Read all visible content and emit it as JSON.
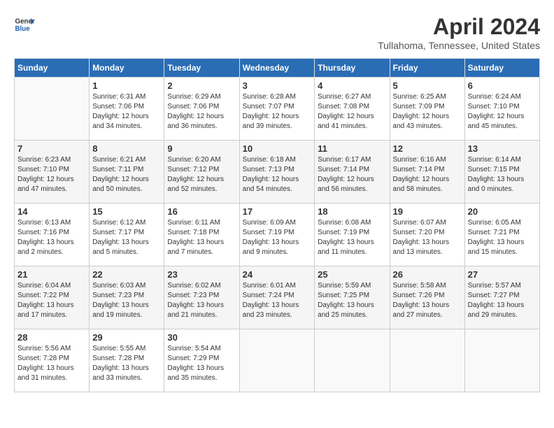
{
  "logo": {
    "general": "General",
    "blue": "Blue"
  },
  "title": {
    "month": "April 2024",
    "location": "Tullahoma, Tennessee, United States"
  },
  "headers": [
    "Sunday",
    "Monday",
    "Tuesday",
    "Wednesday",
    "Thursday",
    "Friday",
    "Saturday"
  ],
  "weeks": [
    [
      {
        "day": "",
        "sunrise": "",
        "sunset": "",
        "daylight": ""
      },
      {
        "day": "1",
        "sunrise": "Sunrise: 6:31 AM",
        "sunset": "Sunset: 7:06 PM",
        "daylight": "Daylight: 12 hours and 34 minutes."
      },
      {
        "day": "2",
        "sunrise": "Sunrise: 6:29 AM",
        "sunset": "Sunset: 7:06 PM",
        "daylight": "Daylight: 12 hours and 36 minutes."
      },
      {
        "day": "3",
        "sunrise": "Sunrise: 6:28 AM",
        "sunset": "Sunset: 7:07 PM",
        "daylight": "Daylight: 12 hours and 39 minutes."
      },
      {
        "day": "4",
        "sunrise": "Sunrise: 6:27 AM",
        "sunset": "Sunset: 7:08 PM",
        "daylight": "Daylight: 12 hours and 41 minutes."
      },
      {
        "day": "5",
        "sunrise": "Sunrise: 6:25 AM",
        "sunset": "Sunset: 7:09 PM",
        "daylight": "Daylight: 12 hours and 43 minutes."
      },
      {
        "day": "6",
        "sunrise": "Sunrise: 6:24 AM",
        "sunset": "Sunset: 7:10 PM",
        "daylight": "Daylight: 12 hours and 45 minutes."
      }
    ],
    [
      {
        "day": "7",
        "sunrise": "Sunrise: 6:23 AM",
        "sunset": "Sunset: 7:10 PM",
        "daylight": "Daylight: 12 hours and 47 minutes."
      },
      {
        "day": "8",
        "sunrise": "Sunrise: 6:21 AM",
        "sunset": "Sunset: 7:11 PM",
        "daylight": "Daylight: 12 hours and 50 minutes."
      },
      {
        "day": "9",
        "sunrise": "Sunrise: 6:20 AM",
        "sunset": "Sunset: 7:12 PM",
        "daylight": "Daylight: 12 hours and 52 minutes."
      },
      {
        "day": "10",
        "sunrise": "Sunrise: 6:18 AM",
        "sunset": "Sunset: 7:13 PM",
        "daylight": "Daylight: 12 hours and 54 minutes."
      },
      {
        "day": "11",
        "sunrise": "Sunrise: 6:17 AM",
        "sunset": "Sunset: 7:14 PM",
        "daylight": "Daylight: 12 hours and 56 minutes."
      },
      {
        "day": "12",
        "sunrise": "Sunrise: 6:16 AM",
        "sunset": "Sunset: 7:14 PM",
        "daylight": "Daylight: 12 hours and 58 minutes."
      },
      {
        "day": "13",
        "sunrise": "Sunrise: 6:14 AM",
        "sunset": "Sunset: 7:15 PM",
        "daylight": "Daylight: 13 hours and 0 minutes."
      }
    ],
    [
      {
        "day": "14",
        "sunrise": "Sunrise: 6:13 AM",
        "sunset": "Sunset: 7:16 PM",
        "daylight": "Daylight: 13 hours and 2 minutes."
      },
      {
        "day": "15",
        "sunrise": "Sunrise: 6:12 AM",
        "sunset": "Sunset: 7:17 PM",
        "daylight": "Daylight: 13 hours and 5 minutes."
      },
      {
        "day": "16",
        "sunrise": "Sunrise: 6:11 AM",
        "sunset": "Sunset: 7:18 PM",
        "daylight": "Daylight: 13 hours and 7 minutes."
      },
      {
        "day": "17",
        "sunrise": "Sunrise: 6:09 AM",
        "sunset": "Sunset: 7:19 PM",
        "daylight": "Daylight: 13 hours and 9 minutes."
      },
      {
        "day": "18",
        "sunrise": "Sunrise: 6:08 AM",
        "sunset": "Sunset: 7:19 PM",
        "daylight": "Daylight: 13 hours and 11 minutes."
      },
      {
        "day": "19",
        "sunrise": "Sunrise: 6:07 AM",
        "sunset": "Sunset: 7:20 PM",
        "daylight": "Daylight: 13 hours and 13 minutes."
      },
      {
        "day": "20",
        "sunrise": "Sunrise: 6:05 AM",
        "sunset": "Sunset: 7:21 PM",
        "daylight": "Daylight: 13 hours and 15 minutes."
      }
    ],
    [
      {
        "day": "21",
        "sunrise": "Sunrise: 6:04 AM",
        "sunset": "Sunset: 7:22 PM",
        "daylight": "Daylight: 13 hours and 17 minutes."
      },
      {
        "day": "22",
        "sunrise": "Sunrise: 6:03 AM",
        "sunset": "Sunset: 7:23 PM",
        "daylight": "Daylight: 13 hours and 19 minutes."
      },
      {
        "day": "23",
        "sunrise": "Sunrise: 6:02 AM",
        "sunset": "Sunset: 7:23 PM",
        "daylight": "Daylight: 13 hours and 21 minutes."
      },
      {
        "day": "24",
        "sunrise": "Sunrise: 6:01 AM",
        "sunset": "Sunset: 7:24 PM",
        "daylight": "Daylight: 13 hours and 23 minutes."
      },
      {
        "day": "25",
        "sunrise": "Sunrise: 5:59 AM",
        "sunset": "Sunset: 7:25 PM",
        "daylight": "Daylight: 13 hours and 25 minutes."
      },
      {
        "day": "26",
        "sunrise": "Sunrise: 5:58 AM",
        "sunset": "Sunset: 7:26 PM",
        "daylight": "Daylight: 13 hours and 27 minutes."
      },
      {
        "day": "27",
        "sunrise": "Sunrise: 5:57 AM",
        "sunset": "Sunset: 7:27 PM",
        "daylight": "Daylight: 13 hours and 29 minutes."
      }
    ],
    [
      {
        "day": "28",
        "sunrise": "Sunrise: 5:56 AM",
        "sunset": "Sunset: 7:28 PM",
        "daylight": "Daylight: 13 hours and 31 minutes."
      },
      {
        "day": "29",
        "sunrise": "Sunrise: 5:55 AM",
        "sunset": "Sunset: 7:28 PM",
        "daylight": "Daylight: 13 hours and 33 minutes."
      },
      {
        "day": "30",
        "sunrise": "Sunrise: 5:54 AM",
        "sunset": "Sunset: 7:29 PM",
        "daylight": "Daylight: 13 hours and 35 minutes."
      },
      {
        "day": "",
        "sunrise": "",
        "sunset": "",
        "daylight": ""
      },
      {
        "day": "",
        "sunrise": "",
        "sunset": "",
        "daylight": ""
      },
      {
        "day": "",
        "sunrise": "",
        "sunset": "",
        "daylight": ""
      },
      {
        "day": "",
        "sunrise": "",
        "sunset": "",
        "daylight": ""
      }
    ]
  ]
}
